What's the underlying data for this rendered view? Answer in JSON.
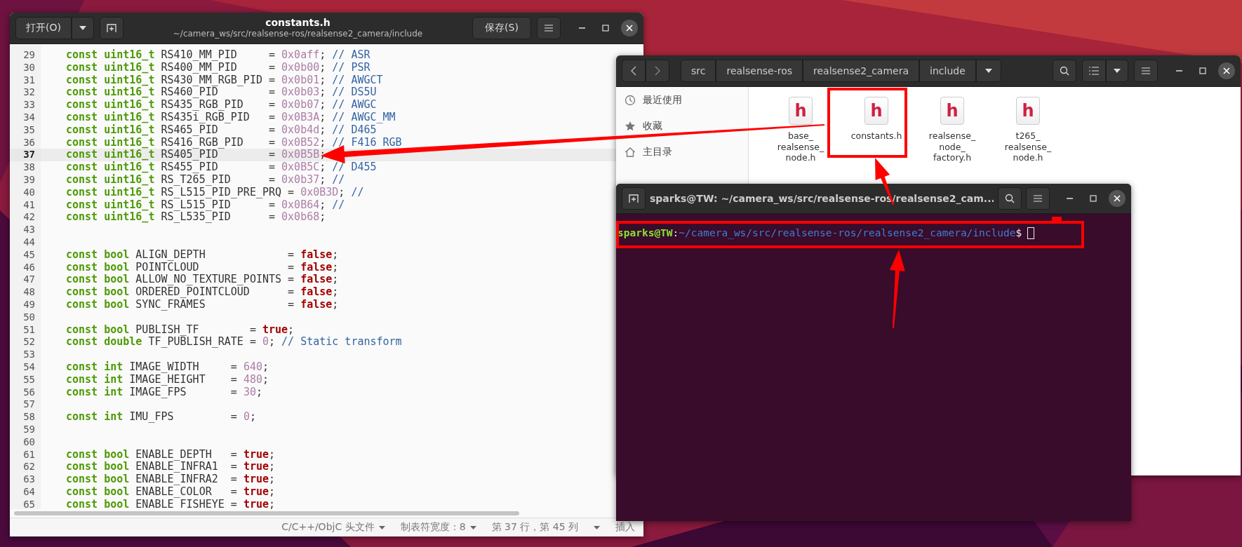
{
  "editor": {
    "title": "constants.h",
    "subtitle": "~/camera_ws/src/realsense-ros/realsense2_camera/include",
    "open_button": "打开(O)",
    "save_button": "保存(S)",
    "lines": [
      {
        "number": "29",
        "current": false,
        "tokens": [
          {
            "kind": "keyword",
            "text": "const uint16_t"
          },
          {
            "kind": "plain",
            "text": " RS410_MM_PID     = "
          },
          {
            "kind": "number",
            "text": "0x0aff"
          },
          {
            "kind": "plain",
            "text": "; "
          },
          {
            "kind": "comment",
            "text": "// ASR"
          }
        ]
      },
      {
        "number": "30",
        "current": false,
        "tokens": [
          {
            "kind": "keyword",
            "text": "const uint16_t"
          },
          {
            "kind": "plain",
            "text": " RS400_MM_PID     = "
          },
          {
            "kind": "number",
            "text": "0x0b00"
          },
          {
            "kind": "plain",
            "text": "; "
          },
          {
            "kind": "comment",
            "text": "// PSR"
          }
        ]
      },
      {
        "number": "31",
        "current": false,
        "tokens": [
          {
            "kind": "keyword",
            "text": "const uint16_t"
          },
          {
            "kind": "plain",
            "text": " RS430_MM_RGB_PID = "
          },
          {
            "kind": "number",
            "text": "0x0b01"
          },
          {
            "kind": "plain",
            "text": "; "
          },
          {
            "kind": "comment",
            "text": "// AWGCT"
          }
        ]
      },
      {
        "number": "32",
        "current": false,
        "tokens": [
          {
            "kind": "keyword",
            "text": "const uint16_t"
          },
          {
            "kind": "plain",
            "text": " RS460_PID        = "
          },
          {
            "kind": "number",
            "text": "0x0b03"
          },
          {
            "kind": "plain",
            "text": "; "
          },
          {
            "kind": "comment",
            "text": "// DS5U"
          }
        ]
      },
      {
        "number": "33",
        "current": false,
        "tokens": [
          {
            "kind": "keyword",
            "text": "const uint16_t"
          },
          {
            "kind": "plain",
            "text": " RS435_RGB_PID    = "
          },
          {
            "kind": "number",
            "text": "0x0b07"
          },
          {
            "kind": "plain",
            "text": "; "
          },
          {
            "kind": "comment",
            "text": "// AWGC"
          }
        ]
      },
      {
        "number": "34",
        "current": false,
        "tokens": [
          {
            "kind": "keyword",
            "text": "const uint16_t"
          },
          {
            "kind": "plain",
            "text": " RS435i_RGB_PID   = "
          },
          {
            "kind": "number",
            "text": "0x0B3A"
          },
          {
            "kind": "plain",
            "text": "; "
          },
          {
            "kind": "comment",
            "text": "// AWGC_MM"
          }
        ]
      },
      {
        "number": "35",
        "current": false,
        "tokens": [
          {
            "kind": "keyword",
            "text": "const uint16_t"
          },
          {
            "kind": "plain",
            "text": " RS465_PID        = "
          },
          {
            "kind": "number",
            "text": "0x0b4d"
          },
          {
            "kind": "plain",
            "text": "; "
          },
          {
            "kind": "comment",
            "text": "// D465"
          }
        ]
      },
      {
        "number": "36",
        "current": false,
        "tokens": [
          {
            "kind": "keyword",
            "text": "const uint16_t"
          },
          {
            "kind": "plain",
            "text": " RS416_RGB_PID    = "
          },
          {
            "kind": "number",
            "text": "0x0B52"
          },
          {
            "kind": "plain",
            "text": "; "
          },
          {
            "kind": "comment",
            "text": "// F416 RGB"
          }
        ]
      },
      {
        "number": "37",
        "current": true,
        "tokens": [
          {
            "kind": "keyword",
            "text": "const uint16_t"
          },
          {
            "kind": "plain",
            "text": " RS405_PID        = "
          },
          {
            "kind": "number",
            "text": "0x0B5B"
          },
          {
            "kind": "plain",
            "text": ";"
          }
        ]
      },
      {
        "number": "38",
        "current": false,
        "tokens": [
          {
            "kind": "keyword",
            "text": "const uint16_t"
          },
          {
            "kind": "plain",
            "text": " RS455_PID        = "
          },
          {
            "kind": "number",
            "text": "0x0B5C"
          },
          {
            "kind": "plain",
            "text": "; "
          },
          {
            "kind": "comment",
            "text": "// D455"
          }
        ]
      },
      {
        "number": "39",
        "current": false,
        "tokens": [
          {
            "kind": "keyword",
            "text": "const uint16_t"
          },
          {
            "kind": "plain",
            "text": " RS_T265_PID      = "
          },
          {
            "kind": "number",
            "text": "0x0b37"
          },
          {
            "kind": "plain",
            "text": "; "
          },
          {
            "kind": "comment",
            "text": "//"
          }
        ]
      },
      {
        "number": "40",
        "current": false,
        "tokens": [
          {
            "kind": "keyword",
            "text": "const uint16_t"
          },
          {
            "kind": "plain",
            "text": " RS_L515_PID_PRE_PRQ = "
          },
          {
            "kind": "number",
            "text": "0x0B3D"
          },
          {
            "kind": "plain",
            "text": "; "
          },
          {
            "kind": "comment",
            "text": "//"
          }
        ]
      },
      {
        "number": "41",
        "current": false,
        "tokens": [
          {
            "kind": "keyword",
            "text": "const uint16_t"
          },
          {
            "kind": "plain",
            "text": " RS_L515_PID      = "
          },
          {
            "kind": "number",
            "text": "0x0B64"
          },
          {
            "kind": "plain",
            "text": "; "
          },
          {
            "kind": "comment",
            "text": "//"
          }
        ]
      },
      {
        "number": "42",
        "current": false,
        "tokens": [
          {
            "kind": "keyword",
            "text": "const uint16_t"
          },
          {
            "kind": "plain",
            "text": " RS_L535_PID      = "
          },
          {
            "kind": "number",
            "text": "0x0b68"
          },
          {
            "kind": "plain",
            "text": ";"
          }
        ]
      },
      {
        "number": "43",
        "current": false
      },
      {
        "number": "44",
        "current": false
      },
      {
        "number": "45",
        "current": false,
        "tokens": [
          {
            "kind": "keyword",
            "text": "const bool"
          },
          {
            "kind": "plain",
            "text": " ALIGN_DEPTH             = "
          },
          {
            "kind": "literal",
            "text": "false"
          },
          {
            "kind": "plain",
            "text": ";"
          }
        ]
      },
      {
        "number": "46",
        "current": false,
        "tokens": [
          {
            "kind": "keyword",
            "text": "const bool"
          },
          {
            "kind": "plain",
            "text": " POINTCLOUD              = "
          },
          {
            "kind": "literal",
            "text": "false"
          },
          {
            "kind": "plain",
            "text": ";"
          }
        ]
      },
      {
        "number": "47",
        "current": false,
        "tokens": [
          {
            "kind": "keyword",
            "text": "const bool"
          },
          {
            "kind": "plain",
            "text": " ALLOW_NO_TEXTURE_POINTS = "
          },
          {
            "kind": "literal",
            "text": "false"
          },
          {
            "kind": "plain",
            "text": ";"
          }
        ]
      },
      {
        "number": "48",
        "current": false,
        "tokens": [
          {
            "kind": "keyword",
            "text": "const bool"
          },
          {
            "kind": "plain",
            "text": " ORDERED_POINTCLOUD      = "
          },
          {
            "kind": "literal",
            "text": "false"
          },
          {
            "kind": "plain",
            "text": ";"
          }
        ]
      },
      {
        "number": "49",
        "current": false,
        "tokens": [
          {
            "kind": "keyword",
            "text": "const bool"
          },
          {
            "kind": "plain",
            "text": " SYNC_FRAMES             = "
          },
          {
            "kind": "literal",
            "text": "false"
          },
          {
            "kind": "plain",
            "text": ";"
          }
        ]
      },
      {
        "number": "50",
        "current": false
      },
      {
        "number": "51",
        "current": false,
        "tokens": [
          {
            "kind": "keyword",
            "text": "const bool"
          },
          {
            "kind": "plain",
            "text": " PUBLISH_TF        = "
          },
          {
            "kind": "literal",
            "text": "true"
          },
          {
            "kind": "plain",
            "text": ";"
          }
        ]
      },
      {
        "number": "52",
        "current": false,
        "tokens": [
          {
            "kind": "keyword",
            "text": "const double"
          },
          {
            "kind": "plain",
            "text": " TF_PUBLISH_RATE = "
          },
          {
            "kind": "number",
            "text": "0"
          },
          {
            "kind": "plain",
            "text": "; "
          },
          {
            "kind": "comment",
            "text": "// Static transform"
          }
        ]
      },
      {
        "number": "53",
        "current": false
      },
      {
        "number": "54",
        "current": false,
        "tokens": [
          {
            "kind": "keyword",
            "text": "const int"
          },
          {
            "kind": "plain",
            "text": " IMAGE_WIDTH     = "
          },
          {
            "kind": "number",
            "text": "640"
          },
          {
            "kind": "plain",
            "text": ";"
          }
        ]
      },
      {
        "number": "55",
        "current": false,
        "tokens": [
          {
            "kind": "keyword",
            "text": "const int"
          },
          {
            "kind": "plain",
            "text": " IMAGE_HEIGHT    = "
          },
          {
            "kind": "number",
            "text": "480"
          },
          {
            "kind": "plain",
            "text": ";"
          }
        ]
      },
      {
        "number": "56",
        "current": false,
        "tokens": [
          {
            "kind": "keyword",
            "text": "const int"
          },
          {
            "kind": "plain",
            "text": " IMAGE_FPS       = "
          },
          {
            "kind": "number",
            "text": "30"
          },
          {
            "kind": "plain",
            "text": ";"
          }
        ]
      },
      {
        "number": "57",
        "current": false
      },
      {
        "number": "58",
        "current": false,
        "tokens": [
          {
            "kind": "keyword",
            "text": "const int"
          },
          {
            "kind": "plain",
            "text": " IMU_FPS         = "
          },
          {
            "kind": "number",
            "text": "0"
          },
          {
            "kind": "plain",
            "text": ";"
          }
        ]
      },
      {
        "number": "59",
        "current": false
      },
      {
        "number": "60",
        "current": false
      },
      {
        "number": "61",
        "current": false,
        "tokens": [
          {
            "kind": "keyword",
            "text": "const bool"
          },
          {
            "kind": "plain",
            "text": " ENABLE_DEPTH   = "
          },
          {
            "kind": "literal",
            "text": "true"
          },
          {
            "kind": "plain",
            "text": ";"
          }
        ]
      },
      {
        "number": "62",
        "current": false,
        "tokens": [
          {
            "kind": "keyword",
            "text": "const bool"
          },
          {
            "kind": "plain",
            "text": " ENABLE_INFRA1  = "
          },
          {
            "kind": "literal",
            "text": "true"
          },
          {
            "kind": "plain",
            "text": ";"
          }
        ]
      },
      {
        "number": "63",
        "current": false,
        "tokens": [
          {
            "kind": "keyword",
            "text": "const bool"
          },
          {
            "kind": "plain",
            "text": " ENABLE_INFRA2  = "
          },
          {
            "kind": "literal",
            "text": "true"
          },
          {
            "kind": "plain",
            "text": ";"
          }
        ]
      },
      {
        "number": "64",
        "current": false,
        "tokens": [
          {
            "kind": "keyword",
            "text": "const bool"
          },
          {
            "kind": "plain",
            "text": " ENABLE_COLOR   = "
          },
          {
            "kind": "literal",
            "text": "true"
          },
          {
            "kind": "plain",
            "text": ";"
          }
        ]
      },
      {
        "number": "65",
        "current": false,
        "tokens": [
          {
            "kind": "keyword",
            "text": "const bool"
          },
          {
            "kind": "plain",
            "text": " ENABLE_FISHEYE = "
          },
          {
            "kind": "literal",
            "text": "true"
          },
          {
            "kind": "plain",
            "text": ";"
          }
        ]
      }
    ],
    "status_bar": {
      "language": "C/C++/ObjC 头文件",
      "tab_width": "制表符宽度：8",
      "position": "第 37 行，第 45 列",
      "mode": "插入"
    }
  },
  "file_manager": {
    "path": [
      {
        "label": "src"
      },
      {
        "label": "realsense-ros"
      },
      {
        "label": "realsense2_camera"
      },
      {
        "label": "include"
      }
    ],
    "sidebar": [
      {
        "label": "最近使用"
      },
      {
        "label": "收藏"
      },
      {
        "label": "主目录"
      }
    ],
    "files": [
      {
        "name": "base_realsense_node.h",
        "icon_text": "h",
        "highlighted": false
      },
      {
        "name": "constants.h",
        "icon_text": "h",
        "highlighted": true
      },
      {
        "name": "realsense_node_factory.h",
        "icon_text": "h",
        "highlighted": false
      },
      {
        "name": "t265_realsense_node.h",
        "icon_text": "h",
        "highlighted": false
      }
    ]
  },
  "terminal": {
    "title": "sparks@TW: ~/camera_ws/src/realsense-ros/realsense2_cam...",
    "prompt_user": "sparks@TW",
    "prompt_separator": ":",
    "prompt_path": "~/camera_ws/src/realsense-ros/realsense2_camera/include",
    "prompt_symbol": "$",
    "prompt_highlighted": true
  }
}
